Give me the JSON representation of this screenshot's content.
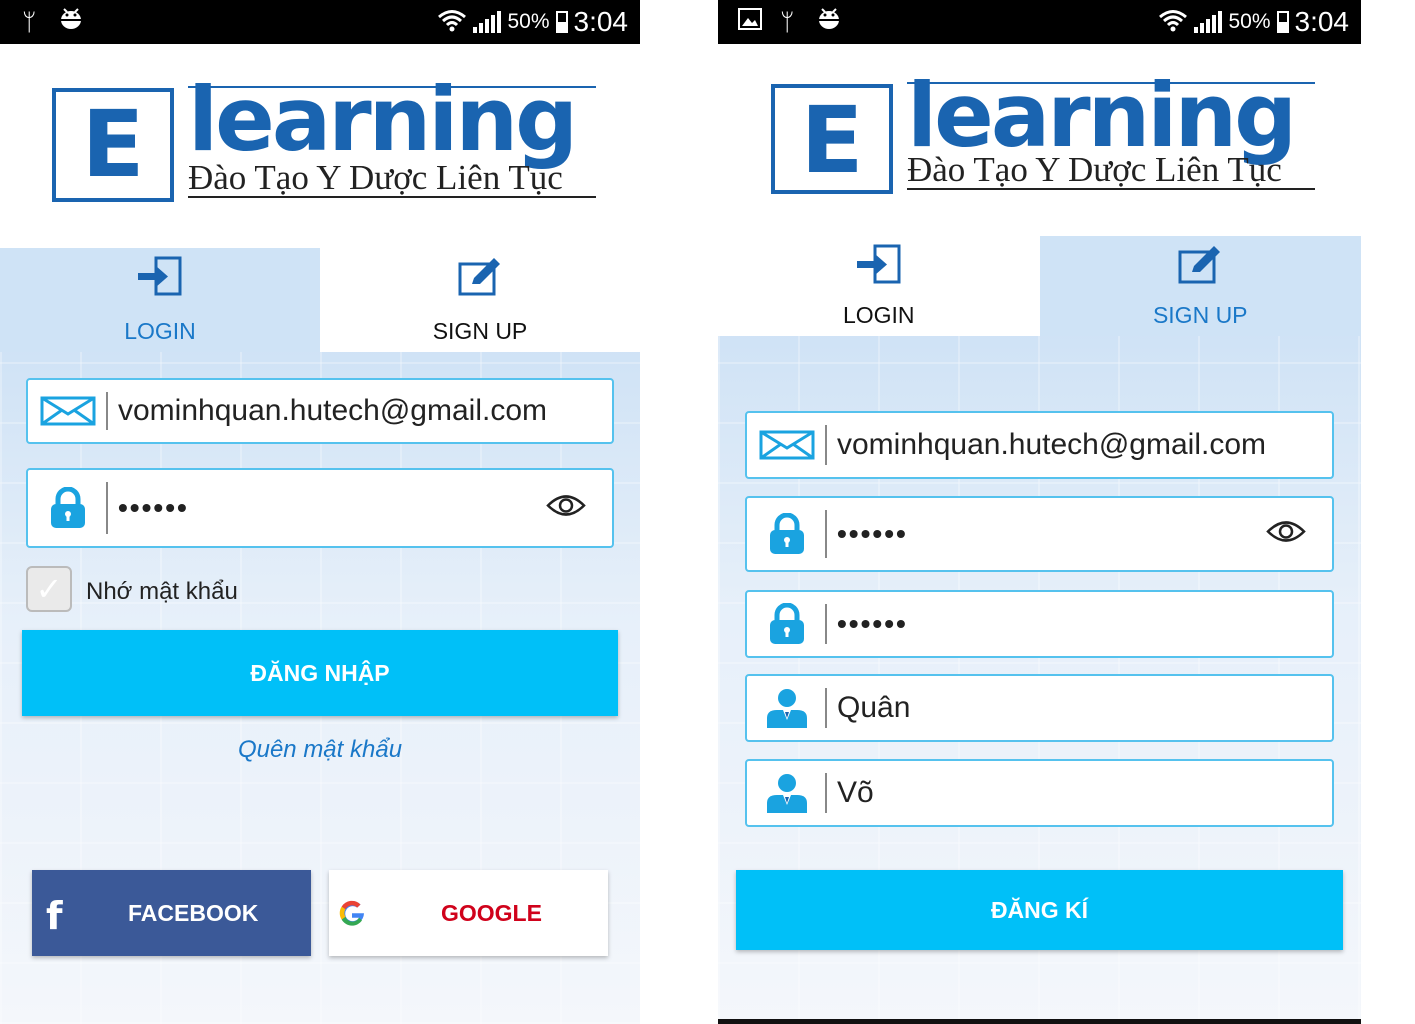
{
  "status_bar": {
    "icons_left": [
      "usb-icon",
      "android-debug-icon"
    ],
    "icons_left_2": [
      "image-icon",
      "usb-icon",
      "android-debug-icon"
    ],
    "battery_percent": "50%",
    "time": "3:04"
  },
  "logo": {
    "letter": "E",
    "word": "learning",
    "tagline": "Đào Tạo Y Dược Liên Tục"
  },
  "tabs": {
    "login": "LOGIN",
    "signup": "SIGN UP"
  },
  "login_screen": {
    "active_tab": "login",
    "email_value": "vominhquan.hutech@gmail.com",
    "password_value": "••••••",
    "remember_label": "Nhớ mật khẩu",
    "remember_checked": true,
    "submit_label": "ĐĂNG NHẬP",
    "forgot_label": "Quên mật khẩu",
    "facebook_label": "FACEBOOK",
    "google_label": "GOOGLE"
  },
  "signup_screen": {
    "active_tab": "signup",
    "email_value": "vominhquan.hutech@gmail.com",
    "password_value": "••••••",
    "confirm_password_value": "••••••",
    "first_name_value": "Quân",
    "last_name_value": "Võ",
    "submit_label": "ĐĂNG KÍ"
  },
  "colors": {
    "brand_blue": "#1a64b0",
    "accent_cyan": "#00c0f8",
    "field_border": "#55c2ee",
    "facebook": "#3b5998",
    "google_red": "#d0021b"
  }
}
